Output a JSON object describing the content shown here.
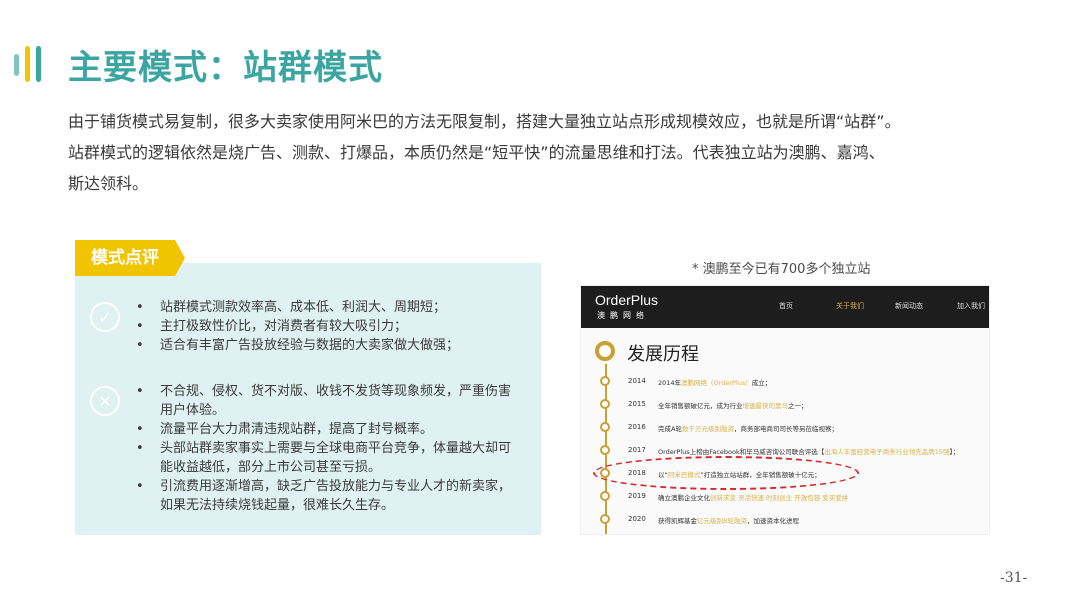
{
  "title": "主要模式：站群模式",
  "intro": [
    "由于铺货模式易复制，很多大卖家使用阿米巴的方法无限复制，搭建大量独立站点形成规模效应，也就是所谓“站群”。",
    "站群模式的逻辑依然是烧广告、测款、打爆品，本质仍然是“短平快”的流量思维和打法。代表独立站为澳鹏、嘉鸿、",
    "斯达领科。"
  ],
  "review": {
    "tag": "模式点评",
    "pros": [
      "站群模式测款效率高、成本低、利润大、周期短；",
      "主打极致性价比，对消费者有较大吸引力；",
      "适合有丰富广告投放经验与数据的大卖家做大做强；"
    ],
    "cons": [
      "不合规、侵权、货不对版、收钱不发货等现象频发，严重伤害用户体验。",
      "流量平台大力肃清违规站群，提高了封号概率。",
      "头部站群卖家事实上需要与全球电商平台竞争，体量越大却可能收益越低，部分上市公司甚至亏损。",
      "引流费用逐渐增高，缺乏广告投放能力与专业人才的新卖家，如果无法持续烧钱起量，很难长久生存。"
    ]
  },
  "caption": "* 澳鹏至今已有700多个独立站",
  "screenshot": {
    "logo": "OrderPlus",
    "logo_sub": "澳鹏网络",
    "nav": [
      "首页",
      "关于我们",
      "新闻动态",
      "加入我们"
    ],
    "heading": "发展历程",
    "timeline": [
      {
        "year": "2014",
        "pre": "2014年",
        "hl": "澳鹏网络（OrderPlus）",
        "post": "成立；"
      },
      {
        "year": "2015",
        "pre": "全年销售额破亿元，成为行业",
        "hl": "增速最快的黑马",
        "post": "之一；"
      },
      {
        "year": "2016",
        "pre": "完成A轮",
        "hl": "数千万元级别融资",
        "post": "，商务部电商司司长等另莅临视察；"
      },
      {
        "year": "2017",
        "pre": "OrderPlus上榜由Facebook和毕马威咨询公司联合评选【",
        "hl": "出海人丰富经营电子商务行业领先品牌15强",
        "post": "】；"
      },
      {
        "year": "2018",
        "pre": "以“",
        "hl": "阿米巴模式",
        "post": "”打造独立站站群，全年销售额破十亿元；"
      },
      {
        "year": "2019",
        "pre": "确立澳鹏企业文化",
        "hl": "创新求变 灵活快速 时刻创业 开放包容 爱买爱拼",
        "post": ""
      },
      {
        "year": "2020",
        "pre": "获得凯辉基金",
        "hl": "亿元级别B轮融资",
        "post": "，加速资本化进程"
      }
    ]
  },
  "page_number": "-31-",
  "colors": {
    "accent": "#3aa5a1",
    "tag": "#f0c400",
    "panel": "#dff1f0",
    "gold": "#c9a032",
    "highlight_ellipse": "#d8282c"
  }
}
